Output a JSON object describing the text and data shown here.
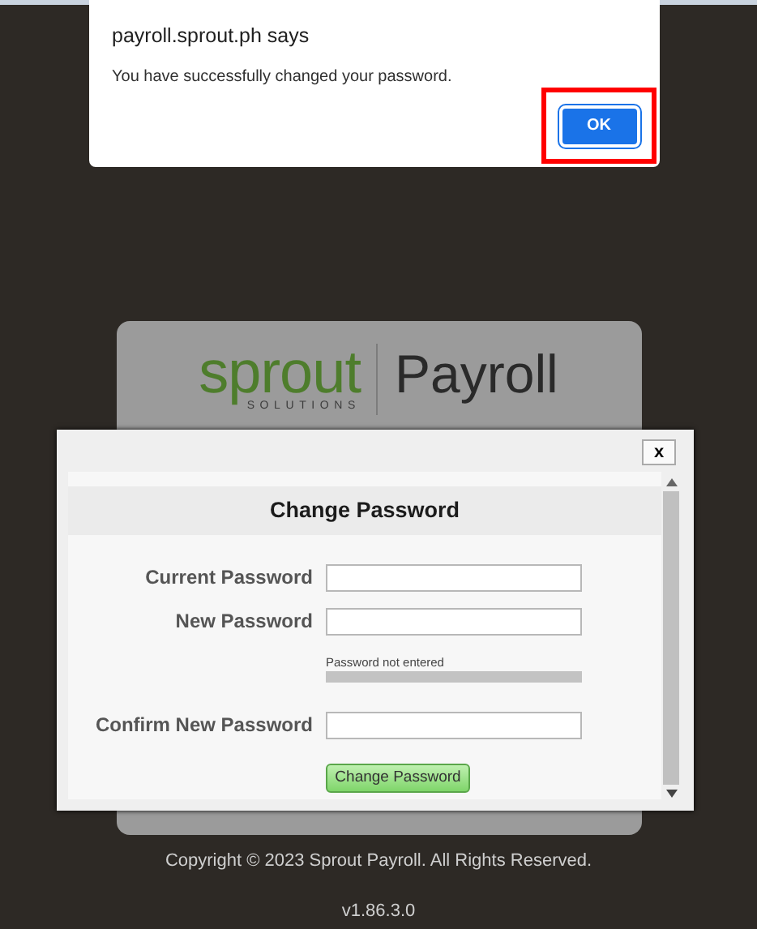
{
  "alert": {
    "title": "payroll.sprout.ph says",
    "message": "You have successfully changed your password.",
    "ok_button": "OK",
    "highlighted": true
  },
  "logo": {
    "brand": "sprout",
    "tagline": "SOLUTIONS",
    "product": "Payroll"
  },
  "modal": {
    "close": "x",
    "title": "Change Password",
    "fields": [
      {
        "label": "Current Password",
        "kind": "input"
      },
      {
        "label": "New Password",
        "kind": "input"
      },
      {
        "kind": "strength",
        "text": "Password not entered",
        "level": 0
      },
      {
        "label": "Confirm New Password",
        "kind": "input"
      }
    ],
    "submit": "Change Password"
  },
  "footer": {
    "copyright": "Copyright © 2023 Sprout Payroll. All Rights Reserved.",
    "version": "v1.86.3.0"
  }
}
